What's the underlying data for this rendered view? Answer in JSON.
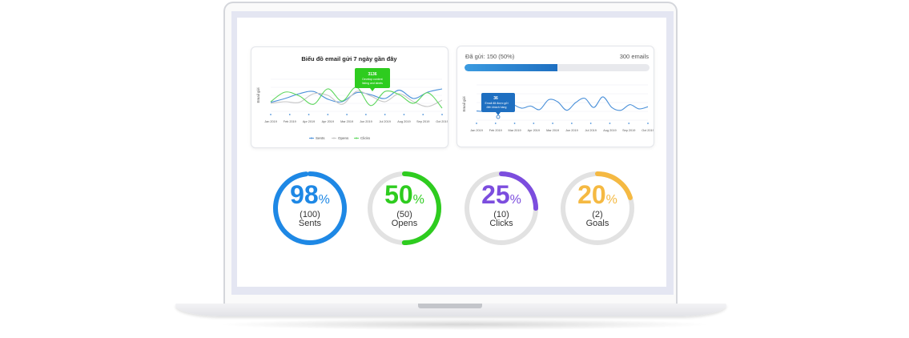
{
  "chart_data": [
    {
      "type": "line",
      "title": "Biểu đồ email gửi 7 ngày gần đây",
      "ylabel": "Email gửi",
      "categories": [
        "Jan 2019",
        "Feb 2019",
        "Apr 2019",
        "Apr 2019",
        "Mar 2019",
        "Jun 2019",
        "Jul 2019",
        "Aug 2019",
        "Sep 2019",
        "Oct 2019"
      ],
      "series": [
        {
          "name": "Sents",
          "color": "#4a90d9",
          "values": [
            28,
            40,
            55,
            62,
            38,
            30,
            58,
            52,
            40,
            66,
            40,
            60,
            70
          ]
        },
        {
          "name": "Opens",
          "color": "#c6c6c6",
          "values": [
            25,
            30,
            28,
            55,
            50,
            22,
            62,
            48,
            30,
            55,
            30,
            15,
            35
          ]
        },
        {
          "name": "Clicks",
          "color": "#5cd65c",
          "values": [
            30,
            60,
            48,
            22,
            70,
            32,
            75,
            18,
            62,
            52,
            25,
            58,
            10
          ]
        }
      ],
      "tooltip": {
        "value": "3136",
        "line1": "Develop content",
        "line2": "listing and labels"
      },
      "legend": "bottom",
      "grid": true
    },
    {
      "type": "line",
      "ylabel": "Email gửi",
      "categories": [
        "Jan 2019",
        "Feb 2019",
        "Mar 2019",
        "Apr 2019",
        "Mar 2019",
        "Jun 2019",
        "Jul 2019",
        "Aug 2019",
        "Sep 2019",
        "Oct 2019"
      ],
      "series": [
        {
          "color": "#4a90d9",
          "values": [
            26,
            26,
            40,
            62,
            46,
            34,
            40,
            30,
            58,
            52,
            28,
            50,
            62,
            36,
            66,
            36,
            28,
            44,
            32,
            38
          ]
        }
      ],
      "tooltip": {
        "value": "36",
        "line1": "Email đã được gửi",
        "line2": "đến khách hàng"
      },
      "grid": true
    }
  ],
  "progress": {
    "label": "Đã gửi: 150 (50%)",
    "total": "300 emails",
    "fraction": 0.5,
    "color": "#1e6fc1"
  },
  "rings": [
    {
      "percent": 98,
      "pct_text": "98",
      "count": "(100)",
      "label": "Sents",
      "color": "#1e88e5"
    },
    {
      "percent": 50,
      "pct_text": "50",
      "count": "(50)",
      "label": "Opens",
      "color": "#2ecc1f"
    },
    {
      "percent": 25,
      "pct_text": "25",
      "count": "(10)",
      "label": "Clicks",
      "color": "#7c4dde"
    },
    {
      "percent": 20,
      "pct_text": "20",
      "count": "(2)",
      "label": "Goals",
      "color": "#f5b942"
    }
  ],
  "percent_symbol": "%"
}
